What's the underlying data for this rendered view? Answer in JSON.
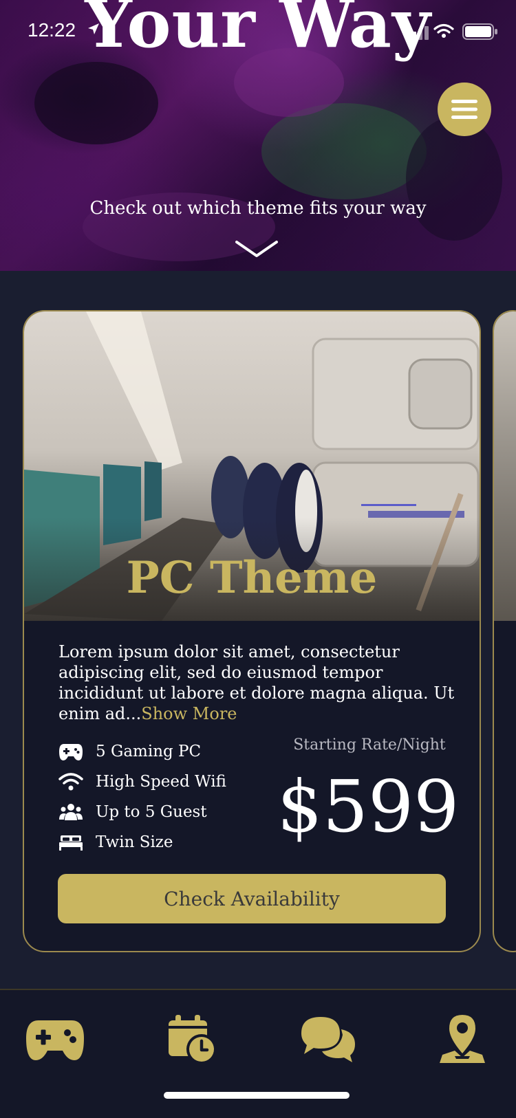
{
  "status_bar": {
    "time": "12:22"
  },
  "hero": {
    "title": "Your Way",
    "subtitle": "Check out which theme fits your way"
  },
  "card": {
    "title": "PC Theme",
    "description": "Lorem ipsum dolor sit amet, consectetur adipiscing elit, sed do eiusmod tempor incididunt ut labore et dolore magna aliqua. Ut enim ad...",
    "show_more": "Show More",
    "features": [
      {
        "icon": "gamepad-icon",
        "label": "5 Gaming PC"
      },
      {
        "icon": "wifi-icon",
        "label": "High Speed Wifi"
      },
      {
        "icon": "users-icon",
        "label": "Up to 5 Guest"
      },
      {
        "icon": "bed-icon",
        "label": "Twin Size"
      }
    ],
    "rate_label": "Starting Rate/Night",
    "price": "$599",
    "cta_label": "Check Availability"
  },
  "bottom_nav": {
    "items": [
      {
        "icon": "gamepad-icon"
      },
      {
        "icon": "calendar-clock-icon"
      },
      {
        "icon": "chat-icon"
      },
      {
        "icon": "map-pin-icon"
      }
    ]
  },
  "colors": {
    "accent": "#c9b660",
    "background": "#1a1e30",
    "card_background": "#141728",
    "hero_purple": "#5a1766"
  }
}
